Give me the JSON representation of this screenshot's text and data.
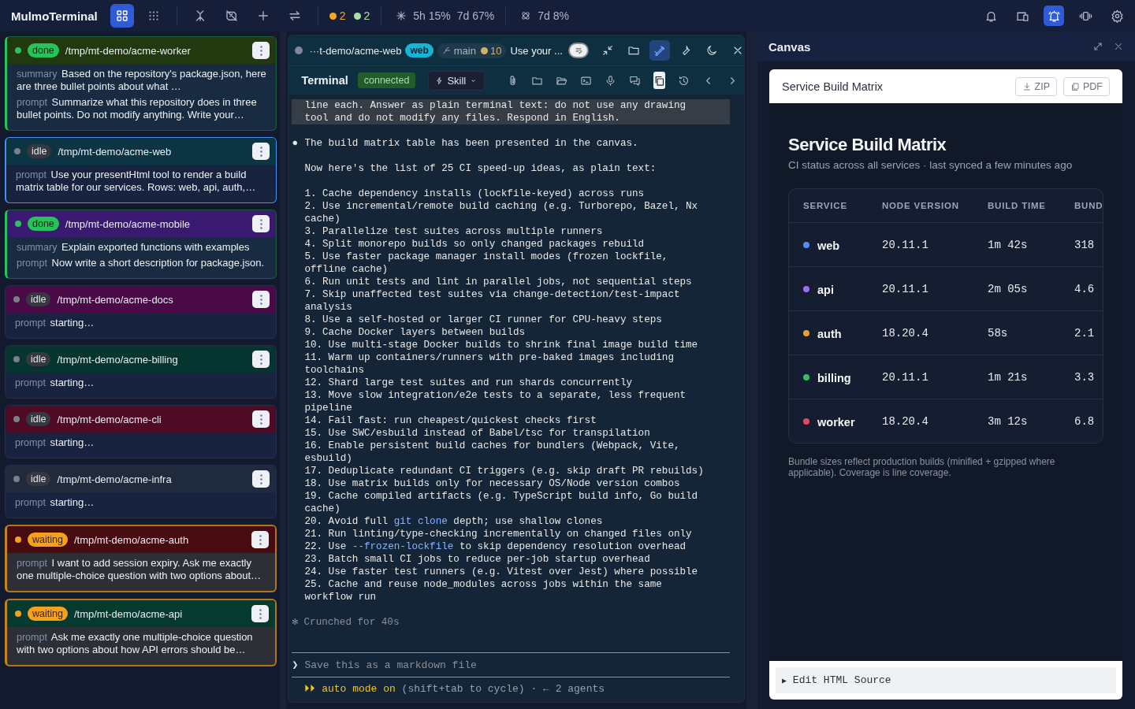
{
  "topbar": {
    "app_title": "MulmoTerminal",
    "view_buttons": [
      {
        "kind": "grid",
        "selected": true
      },
      {
        "kind": "dots",
        "selected": false
      }
    ],
    "counts": [
      {
        "value": "2",
        "color": "#f5a623"
      },
      {
        "value": "2",
        "color": "#a8e0a0"
      }
    ],
    "usage": [
      "5h 15%",
      "7d 67%"
    ],
    "usage_weekly": "7d 8%",
    "right_buttons": [
      {
        "kind": "bell",
        "selected": false
      },
      {
        "kind": "devices",
        "selected": false
      },
      {
        "kind": "bell-ring",
        "selected": true
      },
      {
        "kind": "vibrate",
        "selected": false
      },
      {
        "kind": "settings",
        "selected": false
      }
    ]
  },
  "sessions": [
    {
      "status": "done",
      "path": "/tmp/mt-demo/acme-worker",
      "color": "#22380e",
      "selected": false,
      "rows": [
        {
          "label": "summary",
          "text": "Based on the repository's package.json, here are three bullet points about what …"
        },
        {
          "label": "prompt",
          "text": "Summarize what this repository does in three bullet points. Do not modify anything. Write your…"
        }
      ]
    },
    {
      "status": "idle",
      "path": "/tmp/mt-demo/acme-web",
      "color": "#0b3543",
      "selected": true,
      "rows": [
        {
          "label": "prompt",
          "text": "Use your presentHtml tool to render a build matrix table for our services. Rows: web, api, auth,…"
        }
      ]
    },
    {
      "status": "done",
      "path": "/tmp/mt-demo/acme-mobile",
      "color": "#3a1a70",
      "selected": false,
      "rows": [
        {
          "label": "summary",
          "text": "Explain exported functions with examples"
        },
        {
          "label": "prompt",
          "text": "Now write a short description for package.json."
        }
      ]
    },
    {
      "status": "idle",
      "path": "/tmp/mt-demo/acme-docs",
      "color": "#4a0a48",
      "selected": false,
      "rows": [
        {
          "label": "prompt",
          "text": "starting…"
        }
      ]
    },
    {
      "status": "idle",
      "path": "/tmp/mt-demo/acme-billing",
      "color": "#063530",
      "selected": false,
      "rows": [
        {
          "label": "prompt",
          "text": "starting…"
        }
      ]
    },
    {
      "status": "idle",
      "path": "/tmp/mt-demo/acme-cli",
      "color": "#4f0a24",
      "selected": false,
      "rows": [
        {
          "label": "prompt",
          "text": "starting…"
        }
      ]
    },
    {
      "status": "idle",
      "path": "/tmp/mt-demo/acme-infra",
      "color": "#1f2a3d",
      "selected": false,
      "rows": [
        {
          "label": "prompt",
          "text": "starting…"
        }
      ]
    },
    {
      "status": "waiting",
      "path": "/tmp/mt-demo/acme-auth",
      "color": "#470c10",
      "selected": false,
      "rows": [
        {
          "label": "prompt",
          "text": "I want to add session expiry. Ask me exactly one multiple-choice question with two options about…"
        }
      ]
    },
    {
      "status": "waiting",
      "path": "/tmp/mt-demo/acme-api",
      "color": "#063a2e",
      "selected": false,
      "rows": [
        {
          "label": "prompt",
          "text": "Ask me exactly one multiple-choice question with two options about how API errors should be…"
        }
      ]
    }
  ],
  "terminal": {
    "session_path": "···t-demo/acme-web",
    "tag": "web",
    "branch": "main",
    "changes": "10",
    "prompt_preview": "Use your ...",
    "header_buttons": [
      {
        "kind": "note",
        "selected": false
      },
      {
        "kind": "collapse",
        "selected": false
      },
      {
        "kind": "folder",
        "selected": false
      },
      {
        "kind": "draw",
        "selected": true
      },
      {
        "kind": "wrench",
        "selected": false
      },
      {
        "kind": "moon",
        "selected": false
      },
      {
        "kind": "close",
        "selected": false
      }
    ],
    "title": "Terminal",
    "connection": "connected",
    "skill_button": "Skill",
    "toolbar": [
      {
        "kind": "attach",
        "selected": false
      },
      {
        "kind": "folder",
        "selected": false
      },
      {
        "kind": "folder-open",
        "selected": false
      },
      {
        "kind": "console",
        "selected": false
      },
      {
        "kind": "mic",
        "selected": false
      },
      {
        "kind": "chat",
        "selected": false
      },
      {
        "kind": "copy",
        "selected": true
      },
      {
        "kind": "history",
        "selected": false
      },
      {
        "kind": "prev",
        "selected": false
      },
      {
        "kind": "next",
        "selected": false
      }
    ],
    "output": [
      {
        "kind": "echo",
        "lines": [
          "line each. Answer as plain terminal text: do not use any drawing",
          "tool and do not modify any files. Respond in English."
        ]
      },
      {
        "kind": "bullet",
        "marker": "●",
        "lines": [
          "The build matrix table has been presented in the canvas."
        ]
      },
      {
        "kind": "text",
        "lines": [
          "Now here's the list of 25 CI speed-up ideas, as plain text:"
        ]
      },
      {
        "kind": "text",
        "lines": [
          "1. Cache dependency installs (lockfile-keyed) across runs",
          "2. Use incremental/remote build caching (e.g. Turborepo, Bazel, Nx",
          "cache)",
          "3. Parallelize test suites across multiple runners",
          "4. Split monorepo builds so only changed packages rebuild",
          "5. Use faster package manager install modes (frozen lockfile,",
          "offline cache)",
          "6. Run unit tests and lint in parallel jobs, not sequential steps",
          "7. Skip unaffected test suites via change-detection/test-impact",
          "analysis",
          "8. Use a self-hosted or larger CI runner for CPU-heavy steps",
          "9. Cache Docker layers between builds",
          "10. Use multi-stage Docker builds to shrink final image build time",
          "11. Warm up containers/runners with pre-baked images including",
          "toolchains",
          "12. Shard large test suites and run shards concurrently",
          "13. Move slow integration/e2e tests to a separate, less frequent",
          "pipeline",
          "14. Fail fast: run cheapest/quickest checks first",
          "15. Use SWC/esbuild instead of Babel/tsc for transpilation",
          "16. Enable persistent build caches for bundlers (Webpack, Vite,",
          "esbuild)",
          "17. Deduplicate redundant CI triggers (e.g. skip draft PR rebuilds)",
          "18. Use matrix builds only for necessary OS/Node version combos",
          "19. Cache compiled artifacts (e.g. TypeScript build info, Go build",
          "cache)",
          {
            "parts": [
              {
                "kind": "plain",
                "text": "20. Avoid full "
              },
              {
                "kind": "code",
                "text": "git clone"
              },
              {
                "kind": "plain",
                "text": " depth; use shallow clones"
              }
            ]
          },
          "21. Run linting/type-checking incrementally on changed files only",
          {
            "parts": [
              {
                "kind": "plain",
                "text": "22. Use "
              },
              {
                "kind": "code",
                "text": "--frozen-lockfile"
              },
              {
                "kind": "plain",
                "text": " to skip dependency resolution overhead"
              }
            ]
          },
          "23. Batch small CI jobs to reduce per-job startup overhead",
          "24. Use faster test runners (e.g. Vitest over Jest) where possible",
          "25. Cache and reuse node_modules across jobs within the same",
          "workflow run"
        ]
      },
      {
        "kind": "status",
        "lines": [
          "✻ Crunched for 40s"
        ]
      }
    ],
    "input": {
      "marker": "❯",
      "placeholder": "Save this as a markdown file"
    },
    "footer": [
      {
        "kind": "mode",
        "text": "⏵⏵ auto mode on"
      },
      {
        "kind": "hint",
        "text": " (shift+tab to cycle) · ← 2 agents"
      }
    ]
  },
  "canvas": {
    "title": "Canvas",
    "doc_title": "Service Build Matrix",
    "export_buttons": [
      {
        "kind": "download",
        "label": "ZIP"
      },
      {
        "kind": "pdf",
        "label": "PDF"
      }
    ],
    "heading": "Service Build Matrix",
    "subtitle": "CI status across all services · last synced a few minutes ago",
    "table": {
      "columns": [
        "SERVICE",
        "NODE VERSION",
        "BUILD TIME",
        "BUND"
      ],
      "rows": [
        {
          "color": "#4f8ff7",
          "cells": [
            "web",
            "20.11.1",
            "1m 42s",
            "318"
          ]
        },
        {
          "color": "#9f6ef5",
          "cells": [
            "api",
            "20.11.1",
            "2m 05s",
            "4.6"
          ]
        },
        {
          "color": "#e8a227",
          "cells": [
            "auth",
            "18.20.4",
            "58s",
            "2.1"
          ]
        },
        {
          "color": "#2fbf6b",
          "cells": [
            "billing",
            "20.11.1",
            "1m 21s",
            "3.3"
          ]
        },
        {
          "color": "#e5485d",
          "cells": [
            "worker",
            "18.20.4",
            "3m 12s",
            "6.8"
          ]
        }
      ]
    },
    "note": "Bundle sizes reflect production builds (minified + gzipped where applicable). Coverage is line coverage.",
    "source_toggle": {
      "marker": "▶",
      "label": "Edit HTML Source",
      "expanded": false
    }
  }
}
